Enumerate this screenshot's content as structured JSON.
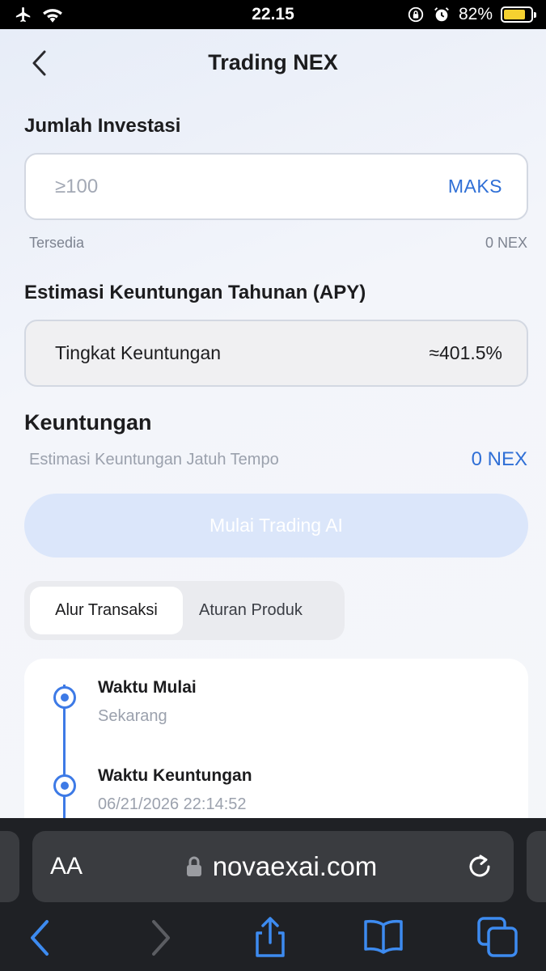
{
  "status_bar": {
    "time": "22.15",
    "battery_percent": "82%",
    "battery_level": 0.82,
    "battery_color": "#f5d130"
  },
  "header": {
    "title": "Trading NEX",
    "back_icon": "chevron-left-icon"
  },
  "investment": {
    "label": "Jumlah Investasi",
    "placeholder": "≥100",
    "value": "",
    "max_label": "MAKS",
    "available_label": "Tersedia",
    "available_value": "0 NEX"
  },
  "apy": {
    "label": "Estimasi Keuntungan Tahunan (APY)",
    "rate_label": "Tingkat Keuntungan",
    "rate_value": "≈401.5%"
  },
  "profit": {
    "title": "Keuntungan",
    "estimate_label": "Estimasi Keuntungan Jatuh Tempo",
    "estimate_value": "0 NEX"
  },
  "start_button": {
    "label": "Mulai Trading AI",
    "enabled": false
  },
  "tabs": [
    {
      "label": "Alur Transaksi",
      "active": true
    },
    {
      "label": "Aturan Produk",
      "active": false
    }
  ],
  "timeline": [
    {
      "title": "Waktu Mulai",
      "subtitle": "Sekarang"
    },
    {
      "title": "Waktu Keuntungan",
      "subtitle": "06/21/2026 22:14:52"
    }
  ],
  "browser": {
    "text_size_label": "AA",
    "url": "novaexai.com"
  },
  "colors": {
    "accent": "#2f6fd6",
    "timeline": "#3d7ae6",
    "disabled_button": "#dbe6fa"
  }
}
